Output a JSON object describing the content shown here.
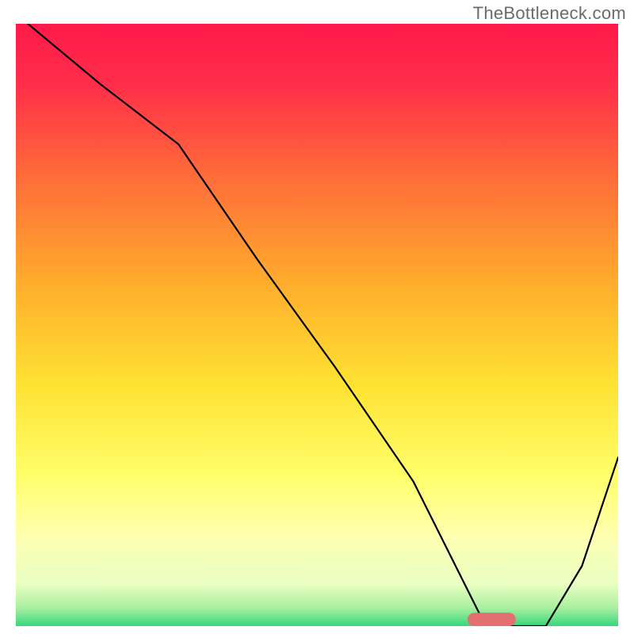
{
  "watermark": "TheBottleneck.com",
  "chart_data": {
    "type": "line",
    "title": "",
    "xlabel": "",
    "ylabel": "",
    "xlim": [
      0,
      100
    ],
    "ylim": [
      0,
      100
    ],
    "grid": false,
    "legend": false,
    "axes_visible": false,
    "background_gradient_stops": [
      {
        "offset": 0.0,
        "color": "#ff1a4b"
      },
      {
        "offset": 0.1,
        "color": "#ff2e49"
      },
      {
        "offset": 0.25,
        "color": "#ff6b3a"
      },
      {
        "offset": 0.45,
        "color": "#ffb32c"
      },
      {
        "offset": 0.6,
        "color": "#ffe233"
      },
      {
        "offset": 0.75,
        "color": "#ffff6b"
      },
      {
        "offset": 0.85,
        "color": "#ffffb0"
      },
      {
        "offset": 0.93,
        "color": "#e9ffc2"
      },
      {
        "offset": 0.97,
        "color": "#a8f0a0"
      },
      {
        "offset": 1.0,
        "color": "#37d77c"
      }
    ],
    "series": [
      {
        "name": "bottleneck-curve",
        "stroke": "#000000",
        "stroke_width": 2.2,
        "x": [
          2,
          14,
          27,
          40,
          53,
          66,
          73,
          77,
          82,
          88,
          94,
          100
        ],
        "values": [
          100,
          90,
          80,
          61,
          43,
          24,
          10,
          2,
          0,
          0,
          10,
          28
        ]
      }
    ],
    "markers": [
      {
        "name": "target-marker",
        "shape": "rounded-bar",
        "x_center": 79,
        "y": 0,
        "width": 8,
        "height": 2.2,
        "fill": "#e27070"
      }
    ]
  }
}
